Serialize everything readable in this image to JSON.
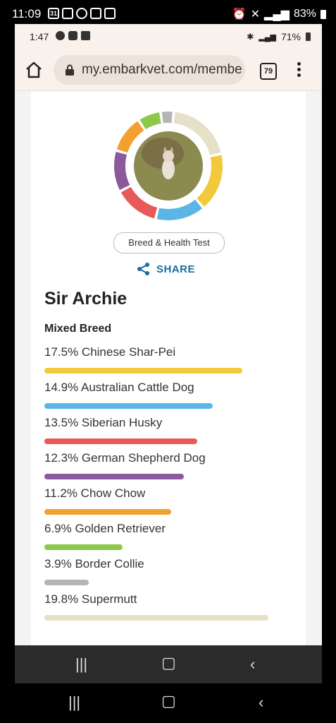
{
  "outer_status": {
    "time": "11:09",
    "calendar_day": "31",
    "battery": "83%"
  },
  "inner_status": {
    "time": "1:47",
    "battery": "71%"
  },
  "browser": {
    "url": "my.embarkvet.com/membe",
    "tab_count": "79"
  },
  "profile": {
    "test_label": "Breed & Health Test",
    "share_label": "SHARE",
    "dog_name": "Sir Archie",
    "breed_type": "Mixed Breed"
  },
  "breeds": [
    {
      "label": "17.5% Chinese Shar-Pei",
      "percent": 17.5,
      "color": "#f2c93a"
    },
    {
      "label": "14.9% Australian Cattle Dog",
      "percent": 14.9,
      "color": "#5bb6e6"
    },
    {
      "label": "13.5% Siberian Husky",
      "percent": 13.5,
      "color": "#e85a5a"
    },
    {
      "label": "12.3% German Shepherd Dog",
      "percent": 12.3,
      "color": "#8a5a9c"
    },
    {
      "label": "11.2% Chow Chow",
      "percent": 11.2,
      "color": "#f2a030"
    },
    {
      "label": "6.9% Golden Retriever",
      "percent": 6.9,
      "color": "#8cc84a"
    },
    {
      "label": "3.9% Border Collie",
      "percent": 3.9,
      "color": "#b5b5b5"
    },
    {
      "label": "19.8% Supermutt",
      "percent": 19.8,
      "color": "#e5e0c8"
    }
  ]
}
